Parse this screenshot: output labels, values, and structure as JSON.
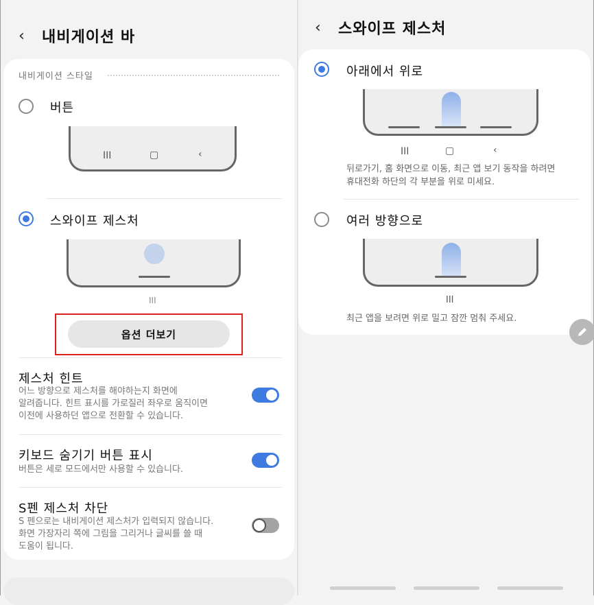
{
  "left": {
    "title": "내비게이션 바",
    "back_glyph": "‹",
    "section_label": "내비게이션 스타일",
    "option_buttons": {
      "label": "버튼",
      "selected": false
    },
    "option_swipe": {
      "label": "스와이프 제스처",
      "selected": true
    },
    "nav_buttons_glyphs": [
      "III",
      "▢",
      "‹"
    ],
    "swipe_hint_glyph": "III",
    "more_options_label": "옵션 더보기",
    "settings": [
      {
        "title": "제스처 힌트",
        "desc": [
          "어느 방향으로 제스처를 해야하는지 화면에",
          "알려줍니다. 힌트 표시를 가로질러 좌우로 움직이면",
          "이전에 사용하던 앱으로 전환할 수 있습니다."
        ],
        "on": true
      },
      {
        "title": "키보드 숨기기 버튼 표시",
        "desc": [
          "버튼은 세로 모드에서만 사용할 수 있습니다."
        ],
        "on": true
      },
      {
        "title": "S펜 제스처 차단",
        "desc": [
          "S 펜으로는 내비게이션 제스처가 입력되지 않습니다.",
          "화면 가장자리 쪽에 그림을 그리거나 글씨를 쓸 때",
          "도움이 됩니다."
        ],
        "on": false
      }
    ]
  },
  "right": {
    "title": "스와이프 제스처",
    "back_glyph": "‹",
    "option_bottom_up": {
      "label": "아래에서 위로",
      "selected": true,
      "glyphs": [
        "III",
        "▢",
        "‹"
      ],
      "desc": [
        "뒤로가기, 홈 화면으로 이동, 최근 앱 보기 동작을 하려면",
        "휴대전화 하단의 각 부분을 위로 미세요."
      ]
    },
    "option_multi": {
      "label": "여러 방향으로",
      "selected": false,
      "glyph": "III",
      "desc": [
        "최근 앱을 보려면 위로 밀고 잠깐 멈춰 주세요."
      ]
    },
    "edit_icon": "pencil-icon"
  },
  "colors": {
    "accent": "#3e7be0",
    "highlight_box": "#e01f1f",
    "toggle_off": "#a3a3a3"
  }
}
